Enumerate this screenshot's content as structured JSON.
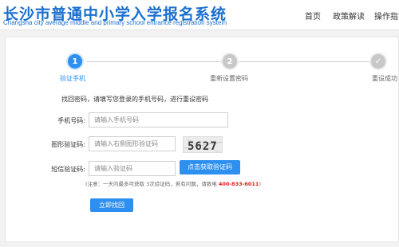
{
  "header": {
    "title": "长沙市普通中小学入学报名系统",
    "subtitle": "Changsha city average middle and primary school entrance registration system",
    "nav": [
      "首页",
      "政策解读",
      "操作指南"
    ]
  },
  "steps": [
    {
      "number": "1",
      "label": "验证手机",
      "state": "active"
    },
    {
      "number": "2",
      "label": "重新设置密码",
      "state": "inactive"
    },
    {
      "number": "✓",
      "label": "重设成功",
      "state": "inactive"
    }
  ],
  "form": {
    "intro": "找回密码，请填写您登录的手机号码，进行重设密码",
    "phone": {
      "label": "手机号码:",
      "placeholder": "请输入手机号码",
      "value": ""
    },
    "captcha": {
      "label": "图形验证码:",
      "placeholder": "请输入右侧图形验证码",
      "value": "",
      "image_text": "5627"
    },
    "sms": {
      "label": "短信验证码:",
      "placeholder": "请输入验证码",
      "value": "",
      "button": "点击获取验证码"
    },
    "note_prefix": "(注意：一天内最多可获取 3次验证码，若有问题，请致电 ",
    "note_phone": "400-833-6011",
    "note_suffix": ")",
    "submit": "立即找回"
  },
  "colors": {
    "accent": "#2d8ff0",
    "title": "#1a6fcf",
    "warning": "#e02020"
  }
}
